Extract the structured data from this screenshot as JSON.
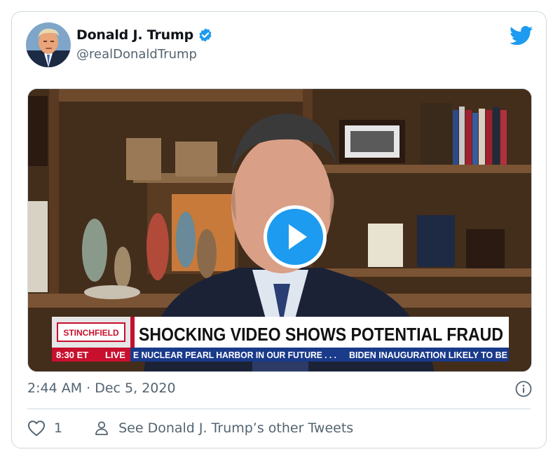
{
  "user": {
    "display_name": "Donald J. Trump",
    "handle": "@realDonaldTrump",
    "verified": true,
    "avatar_icon": "person-avatar"
  },
  "brand": {
    "logo_icon": "twitter-bird-icon",
    "color": "#1d9bf0"
  },
  "media": {
    "type": "video",
    "play_icon": "play-icon",
    "lower_third": {
      "show_name": "STINCHFIELD",
      "headline": "SHOCKING VIDEO SHOWS POTENTIAL FRAUD",
      "time": "8:30 ET",
      "live": "LIVE",
      "ticker_left": "E NUCLEAR PEARL HARBOR IN OUR FUTURE . . .",
      "ticker_right": "BIDEN INAUGURATION LIKELY TO BE"
    }
  },
  "meta": {
    "timestamp": "2:44 AM · Dec 5, 2020"
  },
  "actions": {
    "like_count": "1",
    "see_more_label": "See Donald J. Trump’s other Tweets"
  },
  "colors": {
    "text_secondary": "#536471",
    "border": "#cfd9de",
    "ticker_red": "#c8102e",
    "ticker_blue": "#1a3a8a"
  }
}
